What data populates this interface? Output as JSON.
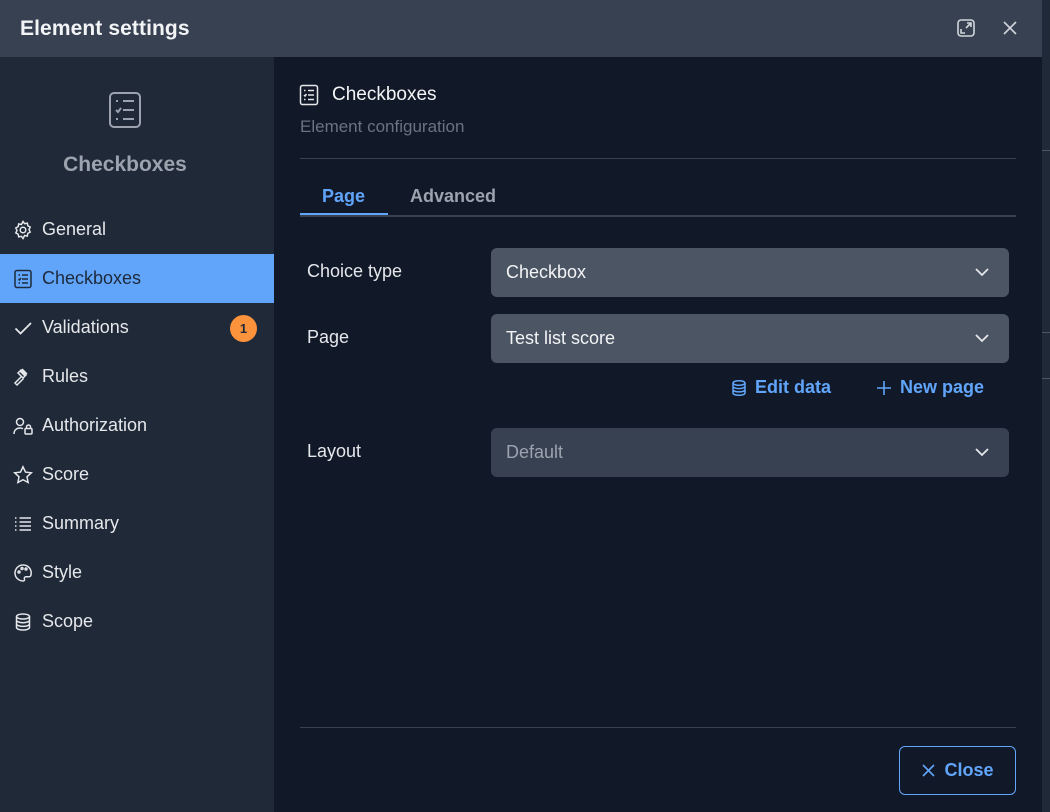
{
  "header": {
    "title": "Element settings",
    "expand_icon": "expand-icon",
    "close_icon": "close-icon"
  },
  "sidebar": {
    "element_icon": "checklist-icon",
    "element_title": "Checkboxes",
    "items": [
      {
        "label": "General",
        "icon": "gear-icon",
        "active": false
      },
      {
        "label": "Checkboxes",
        "icon": "checklist-icon",
        "active": true
      },
      {
        "label": "Validations",
        "icon": "check-icon",
        "active": false,
        "badge": "1"
      },
      {
        "label": "Rules",
        "icon": "gavel-icon",
        "active": false
      },
      {
        "label": "Authorization",
        "icon": "user-lock-icon",
        "active": false
      },
      {
        "label": "Score",
        "icon": "star-icon",
        "active": false
      },
      {
        "label": "Summary",
        "icon": "list-icon",
        "active": false
      },
      {
        "label": "Style",
        "icon": "palette-icon",
        "active": false
      },
      {
        "label": "Scope",
        "icon": "database-icon",
        "active": false
      }
    ]
  },
  "main": {
    "title": "Checkboxes",
    "subtitle": "Element configuration",
    "tabs": [
      {
        "label": "Page",
        "active": true
      },
      {
        "label": "Advanced",
        "active": false
      }
    ],
    "fields": {
      "choice_type": {
        "label": "Choice type",
        "value": "Checkbox"
      },
      "page": {
        "label": "Page",
        "value": "Test list score"
      },
      "layout": {
        "label": "Layout",
        "value": "Default"
      }
    },
    "links": {
      "edit_data": "Edit data",
      "new_page": "New page"
    }
  },
  "footer": {
    "close_label": "Close"
  },
  "colors": {
    "accent": "#60a5fa",
    "badge": "#fb923c",
    "header_bg": "#374151",
    "sidebar_bg": "#1f2937",
    "main_bg": "#111827"
  }
}
